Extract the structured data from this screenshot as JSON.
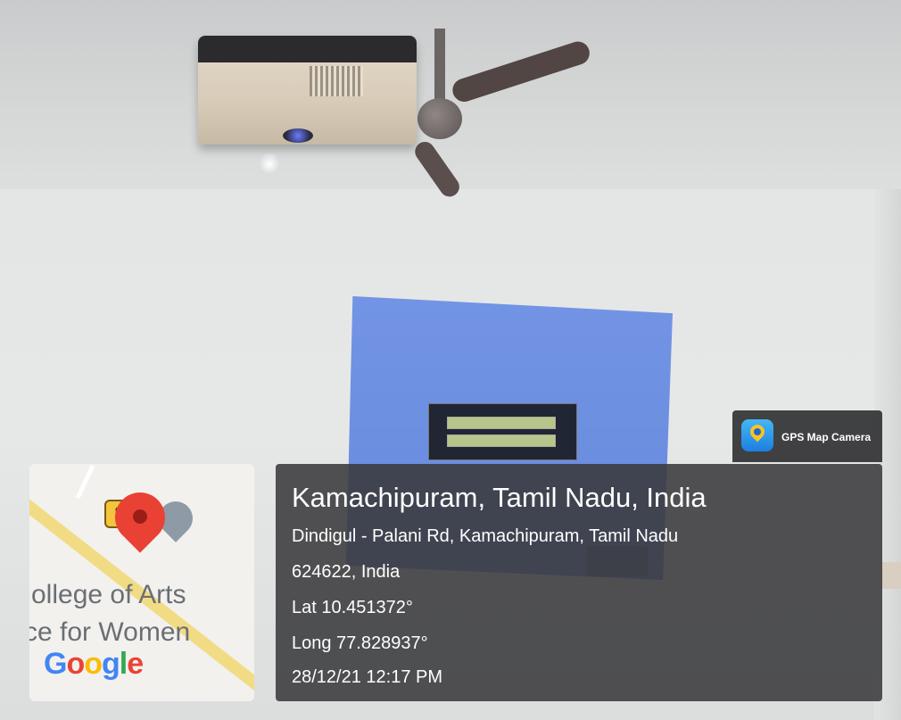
{
  "map": {
    "shield_number": "8",
    "label_line1": "ollege of Arts",
    "label_line2": "ce for Women",
    "logo_letters": [
      "G",
      "o",
      "o",
      "g",
      "l",
      "e"
    ],
    "more": "..."
  },
  "badge": {
    "icon": "gps-map-camera-icon",
    "label": "GPS Map Camera"
  },
  "location": {
    "headline": "Kamachipuram, Tamil Nadu, India",
    "address_line1": "Dindigul - Palani Rd, Kamachipuram, Tamil Nadu",
    "address_line2": "624622, India",
    "lat": "Lat 10.451372°",
    "long": "Long 77.828937°",
    "datetime": "28/12/21 12:17 PM"
  },
  "colors": {
    "overlay": "#3a3a3c",
    "projection": "#6c8ee0",
    "pin": "#e94235"
  }
}
